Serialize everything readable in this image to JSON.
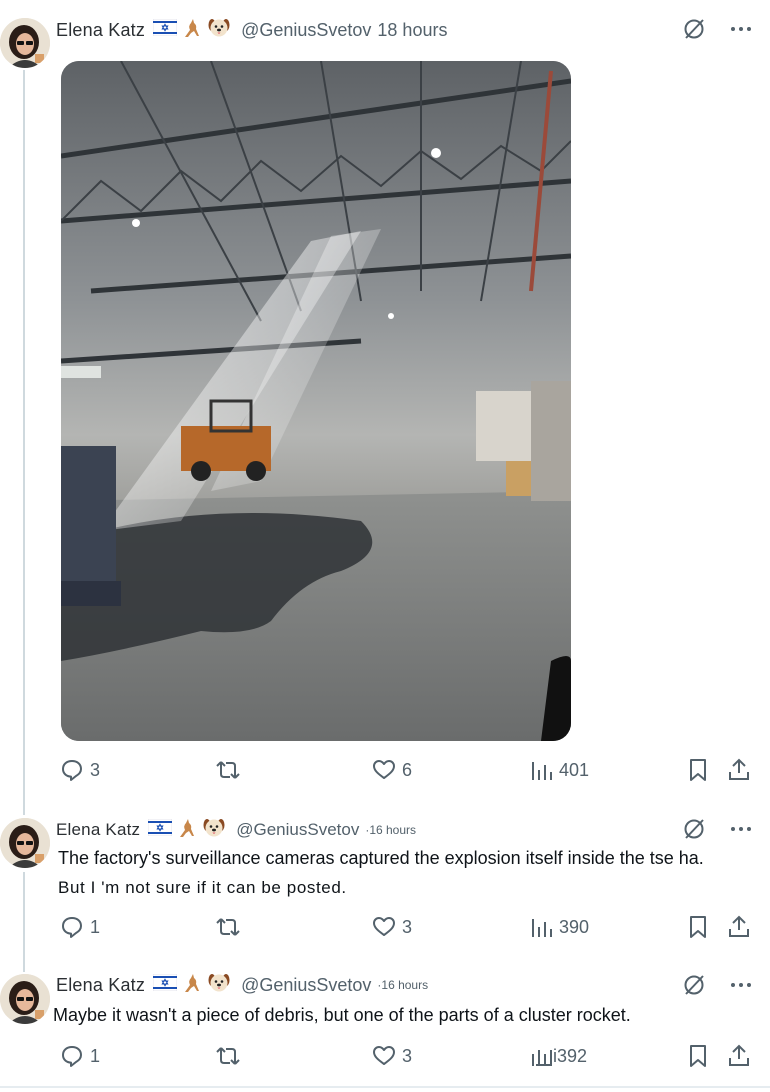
{
  "colors": {
    "text": "#0f1419",
    "muted": "#53616b",
    "line": "#cfd9de"
  },
  "posts": [
    {
      "author": "Elena Katz",
      "handle": "@GeniusSvetov",
      "time": "18 hours",
      "badges": [
        "israel-flag",
        "kangaroo-emoji",
        "dog-face-emoji"
      ],
      "text": "",
      "has_photo": true,
      "replies": "3",
      "reposts": "",
      "likes": "6",
      "views": "401"
    },
    {
      "author": "Elena Katz",
      "handle": "@GeniusSvetov",
      "time": "·16 hours",
      "badges": [
        "israel-flag",
        "kangaroo-emoji",
        "dog-face-emoji"
      ],
      "text_line1": "The factory's surveillance cameras captured the explosion itself inside the tse ha.",
      "text_line2": "But I 'm not sure if it can be posted.",
      "replies": "1",
      "reposts": "",
      "likes": "3",
      "views": "390"
    },
    {
      "author": "Elena Katz",
      "handle": "@GeniusSvetov",
      "time": "·16 hours",
      "badges": [
        "israel-flag",
        "kangaroo-emoji",
        "dog-face-emoji"
      ],
      "text": "Maybe it wasn't a piece of debris, but one of the parts of a cluster rocket.",
      "replies": "1",
      "reposts": "",
      "likes": "3",
      "views": "i392"
    }
  ]
}
